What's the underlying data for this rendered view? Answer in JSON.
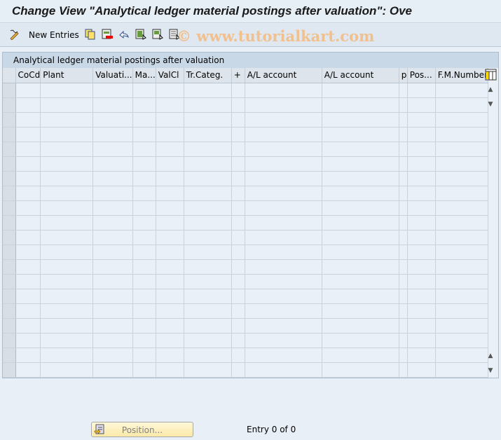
{
  "title": "Change View \"Analytical ledger material postings after valuation\": Ove",
  "toolbar": {
    "new_entries": "New Entries",
    "watermark": "© www.tutorialkart.com",
    "icons": [
      "change-display-icon",
      "copy-icon",
      "delete-icon",
      "undo-icon",
      "select-all-icon",
      "select-block-icon",
      "deselect-all-icon"
    ]
  },
  "table": {
    "title": "Analytical ledger material postings after valuation",
    "columns": [
      "CoCd",
      "Plant",
      "Valuati...",
      "Ma...",
      "ValCl",
      "Tr.Categ.",
      "+",
      "A/L account",
      "A/L account",
      "p",
      "Pos...",
      "F.M.Number"
    ],
    "row_count_visible": 20
  },
  "footer": {
    "position_label": "Position...",
    "entry_text": "Entry 0 of 0"
  }
}
